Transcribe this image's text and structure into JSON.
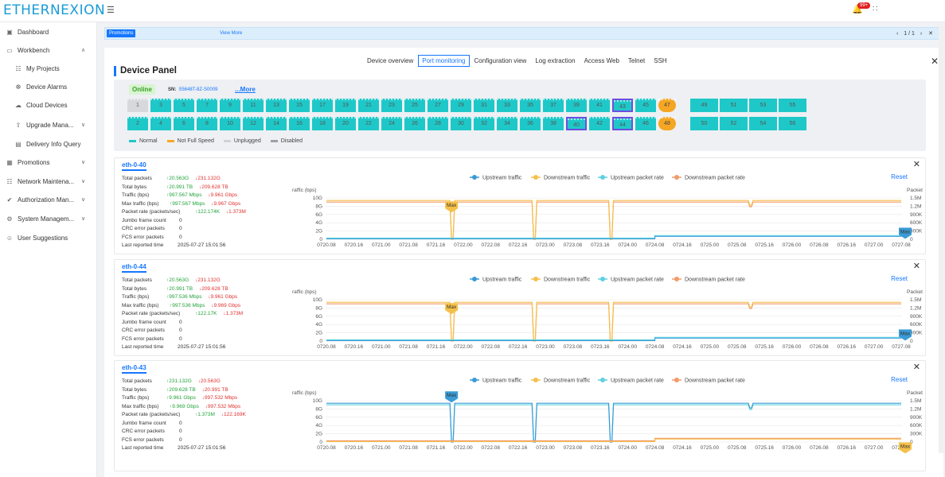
{
  "header": {
    "logo": "ETHERNEXION",
    "notif_count": "99+"
  },
  "sidebar": {
    "items": [
      {
        "label": "Dashboard",
        "icon": "dashboard-icon",
        "expandable": false
      },
      {
        "label": "Workbench",
        "icon": "workbench-icon",
        "expandable": true,
        "expanded": true
      },
      {
        "label": "My Projects",
        "icon": "projects-icon",
        "sub": true
      },
      {
        "label": "Device Alarms",
        "icon": "alarm-icon",
        "sub": true
      },
      {
        "label": "Cloud Devices",
        "icon": "cloud-icon",
        "sub": true
      },
      {
        "label": "Upgrade Mana...",
        "icon": "upgrade-icon",
        "sub": true,
        "expandable": true
      },
      {
        "label": "Delivery Info Query",
        "icon": "delivery-icon",
        "sub": true
      },
      {
        "label": "Promotions",
        "icon": "promotions-icon",
        "expandable": true
      },
      {
        "label": "Network Maintena...",
        "icon": "network-icon",
        "expandable": true
      },
      {
        "label": "Authorization Man...",
        "icon": "authorization-icon",
        "expandable": true
      },
      {
        "label": "System Managem...",
        "icon": "system-icon",
        "expandable": true
      },
      {
        "label": "User Suggestions",
        "icon": "suggestions-icon",
        "expandable": false
      }
    ]
  },
  "promo": {
    "tag": "Promotions",
    "link": "View More",
    "page": "1 / 1"
  },
  "panel": {
    "title": "Device Panel",
    "tabs": [
      "Device overview",
      "Port monitoring",
      "Configuration view",
      "Log extraction",
      "Access Web",
      "Telnet",
      "SSH"
    ],
    "active_tab": 1
  },
  "device": {
    "status": "Online",
    "sn_label": "SN:",
    "sn": "S5648T-8Z-S0009",
    "more": "...More",
    "ports_top": [
      {
        "n": "1",
        "s": "disabled"
      },
      {
        "n": "3"
      },
      {
        "n": "5"
      },
      {
        "n": "7"
      },
      {
        "n": "9"
      },
      {
        "n": "11"
      },
      {
        "n": "13"
      },
      {
        "n": "15"
      },
      {
        "n": "17"
      },
      {
        "n": "19"
      },
      {
        "n": "21"
      },
      {
        "n": "23"
      },
      {
        "n": "25"
      },
      {
        "n": "27"
      },
      {
        "n": "29"
      },
      {
        "n": "31"
      },
      {
        "n": "33"
      },
      {
        "n": "35"
      },
      {
        "n": "37"
      },
      {
        "n": "39"
      },
      {
        "n": "41"
      },
      {
        "n": "43",
        "sel": true
      },
      {
        "n": "45"
      },
      {
        "n": "47",
        "s": "notfull"
      }
    ],
    "ports_bottom": [
      {
        "n": "2"
      },
      {
        "n": "4"
      },
      {
        "n": "6"
      },
      {
        "n": "8"
      },
      {
        "n": "10"
      },
      {
        "n": "12"
      },
      {
        "n": "14"
      },
      {
        "n": "16"
      },
      {
        "n": "18"
      },
      {
        "n": "20"
      },
      {
        "n": "22"
      },
      {
        "n": "24"
      },
      {
        "n": "26"
      },
      {
        "n": "28"
      },
      {
        "n": "30"
      },
      {
        "n": "32"
      },
      {
        "n": "34"
      },
      {
        "n": "36"
      },
      {
        "n": "38"
      },
      {
        "n": "40",
        "sel": true
      },
      {
        "n": "42"
      },
      {
        "n": "44",
        "sel": true
      },
      {
        "n": "46"
      },
      {
        "n": "48",
        "s": "notfull"
      }
    ],
    "uplinks_top": [
      "49",
      "51",
      "53",
      "55"
    ],
    "uplinks_bottom": [
      "50",
      "52",
      "54",
      "56"
    ],
    "legend": [
      {
        "label": "Normal",
        "color": "#1fc8c8"
      },
      {
        "label": "Not Full Speed",
        "color": "#f5a623"
      },
      {
        "label": "Unplugged",
        "color": "#cfd3d8"
      },
      {
        "label": "Disabled",
        "color": "#9aa0a6"
      }
    ]
  },
  "monitor_labels": {
    "packets": "Total packets",
    "bytes": "Total bytes",
    "traffic": "Traffic (bps)",
    "max": "Max traffic (bps)",
    "rate": "Packet rate (packets/sec)",
    "jumbo": "Jumbo frame count",
    "crc": "CRC error packets",
    "fcs": "FCS error packets",
    "reported": "Last reported time",
    "reset": "Reset",
    "y_left": "raffic (bps)",
    "y_right": "Packet rate (packets/sec)",
    "max_marker": "Max"
  },
  "chart_legend": [
    "Upstream traffic",
    "Downstream traffic",
    "Upstream packet rate",
    "Downstream packet rate"
  ],
  "series_colors": {
    "up_traffic": "#3a9bd5",
    "down_traffic": "#f5c04a",
    "up_rate": "#5fd0e0",
    "down_rate": "#f29a6b"
  },
  "ports_monitor": [
    {
      "name": "eth-0-40",
      "packets_up": "20.563G",
      "packets_dn": "231.132G",
      "bytes_up": "20.991 TB",
      "bytes_dn": "209.628 TB",
      "traffic_up": "997.567 Mbps",
      "traffic_dn": "9.961 Gbps",
      "max_up": "997.567 Mbps",
      "max_dn": "9.967 Gbps",
      "rate_up": "122.174K",
      "rate_dn": "1.373M",
      "jumbo": "0",
      "crc": "0",
      "fcs": "0",
      "time": "2025-07-27 15:01:56"
    },
    {
      "name": "eth-0-44",
      "packets_up": "20.563G",
      "packets_dn": "231.132G",
      "bytes_up": "20.991 TB",
      "bytes_dn": "209.628 TB",
      "traffic_up": "997.536 Mbps",
      "traffic_dn": "9.961 Gbps",
      "max_up": "997.536 Mbps",
      "max_dn": "9.969 Gbps",
      "rate_up": "122.17K",
      "rate_dn": "1.373M",
      "jumbo": "0",
      "crc": "0",
      "fcs": "0",
      "time": "2025-07-27 15:01:56"
    },
    {
      "name": "eth-0-43",
      "packets_up": "231.132G",
      "packets_dn": "20.563G",
      "bytes_up": "209.628 TB",
      "bytes_dn": "20.991 TB",
      "traffic_up": "9.961 Gbps",
      "traffic_dn": "997.532 Mbps",
      "max_up": "9.969 Gbps",
      "max_dn": "997.532 Mbps",
      "rate_up": "1.373M",
      "rate_dn": "122.169K",
      "jumbo": "0",
      "crc": "0",
      "fcs": "0",
      "time": "2025-07-27 15:01:56"
    }
  ],
  "chart_data": [
    {
      "type": "line",
      "title": "eth-0-40",
      "xlabel": "",
      "ylabel": "raffic (bps)",
      "y2label": "Packet rate (packets/sec)",
      "x": [
        "0720.08",
        "0720.16",
        "0721.00",
        "0721.08",
        "0721.16",
        "0722.00",
        "0722.08",
        "0722.16",
        "0723.00",
        "0723.08",
        "0723.16",
        "0724.00",
        "0724.08",
        "0724.16",
        "0725.00",
        "0725.08",
        "0725.16",
        "0726.00",
        "0726.08",
        "0726.16",
        "0727.00",
        "0727.08"
      ],
      "yticks": [
        "0",
        "2G",
        "4G",
        "6G",
        "8G",
        "10G"
      ],
      "y2ticks": [
        "0",
        "300K",
        "600K",
        "900K",
        "1.2M",
        "1.5M"
      ],
      "ylim": [
        0,
        10
      ],
      "y2lim": [
        0,
        1.5
      ],
      "series": [
        {
          "name": "Downstream traffic",
          "values": [
            9.0,
            9.0,
            9.0,
            9.0,
            9.0,
            9.0,
            9.0,
            9.0,
            9.0,
            9.0,
            9.0,
            9.0,
            9.0,
            9.0,
            9.0,
            9.0,
            9.0,
            9.0,
            9.0,
            9.0,
            9.0,
            9.0
          ],
          "dips": [
            4.6,
            7.6,
            10.4
          ],
          "small_dip": 15.5
        },
        {
          "name": "Upstream traffic",
          "values": [
            0.3,
            0.3,
            0.3,
            0.3,
            0.3,
            0.3,
            0.3,
            0.3,
            0.3,
            0.3,
            0.3,
            0.3,
            0.9,
            0.9,
            0.9,
            0.9,
            0.9,
            0.9,
            0.9,
            0.9,
            0.9,
            0.9
          ]
        }
      ],
      "max_markers": [
        "Downstream traffic",
        "Upstream traffic"
      ]
    },
    {
      "type": "line",
      "title": "eth-0-44",
      "ylabel": "raffic (bps)",
      "y2label": "Packet rate (packets/sec)",
      "x": [
        "0720.08",
        "0720.16",
        "0721.00",
        "0721.08",
        "0721.16",
        "0722.00",
        "0722.08",
        "0722.16",
        "0723.00",
        "0723.08",
        "0723.16",
        "0724.00",
        "0724.08",
        "0724.16",
        "0725.00",
        "0725.08",
        "0725.16",
        "0726.00",
        "0726.08",
        "0726.16",
        "0727.00",
        "0727.08"
      ],
      "yticks": [
        "0",
        "2G",
        "4G",
        "6G",
        "8G",
        "10G"
      ],
      "y2ticks": [
        "0",
        "300K",
        "600K",
        "900K",
        "1.2M",
        "1.5M"
      ],
      "ylim": [
        0,
        10
      ],
      "y2lim": [
        0,
        1.5
      ],
      "series": [
        {
          "name": "Downstream traffic",
          "values": [
            9.0,
            9.0,
            9.0,
            9.0,
            9.0,
            9.0,
            9.0,
            9.0,
            9.0,
            9.0,
            9.0,
            9.0,
            9.0,
            9.0,
            9.0,
            9.0,
            9.0,
            9.0,
            9.0,
            9.0,
            9.0,
            9.0
          ],
          "dips": [
            4.6,
            7.6,
            10.4
          ],
          "small_dip": 15.5
        },
        {
          "name": "Upstream traffic",
          "values": [
            0.3,
            0.3,
            0.3,
            0.3,
            0.3,
            0.3,
            0.3,
            0.3,
            0.3,
            0.3,
            0.3,
            0.3,
            0.9,
            0.9,
            0.9,
            0.9,
            0.9,
            0.9,
            0.9,
            0.9,
            0.9,
            0.9
          ]
        }
      ],
      "max_markers": [
        "Downstream traffic",
        "Upstream traffic"
      ]
    },
    {
      "type": "line",
      "title": "eth-0-43",
      "ylabel": "raffic (bps)",
      "y2label": "Packet rate (packets/sec)",
      "x": [
        "0720.08",
        "0720.16",
        "0721.00",
        "0721.08",
        "0721.16",
        "0722.00",
        "0722.08",
        "0722.16",
        "0723.00",
        "0723.08",
        "0723.16",
        "0724.00",
        "0724.08",
        "0724.16",
        "0725.00",
        "0725.08",
        "0725.16",
        "0726.00",
        "0726.08",
        "0726.16",
        "0727.00",
        "0727.08"
      ],
      "yticks": [
        "0",
        "2G",
        "4G",
        "6G",
        "8G",
        "10G"
      ],
      "y2ticks": [
        "0",
        "300K",
        "600K",
        "900K",
        "1.2M",
        "1.5M"
      ],
      "ylim": [
        0,
        10
      ],
      "y2lim": [
        0,
        1.5
      ],
      "series": [
        {
          "name": "Upstream traffic",
          "values": [
            9.0,
            9.0,
            9.0,
            9.0,
            9.0,
            9.0,
            9.0,
            9.0,
            9.0,
            9.0,
            9.0,
            9.0,
            9.0,
            9.0,
            9.0,
            9.0,
            9.0,
            9.0,
            9.0,
            9.0,
            9.0,
            9.0
          ],
          "dips": [
            4.6,
            7.6,
            10.4
          ],
          "small_dip": 15.5
        },
        {
          "name": "Downstream traffic",
          "values": [
            0.3,
            0.3,
            0.3,
            0.3,
            0.3,
            0.3,
            0.3,
            0.3,
            0.3,
            0.3,
            0.3,
            0.3,
            0.9,
            0.9,
            0.9,
            0.9,
            0.9,
            0.9,
            0.9,
            0.9,
            0.9,
            0.9
          ]
        }
      ],
      "max_markers": [
        "Upstream traffic",
        "Downstream traffic"
      ]
    }
  ]
}
